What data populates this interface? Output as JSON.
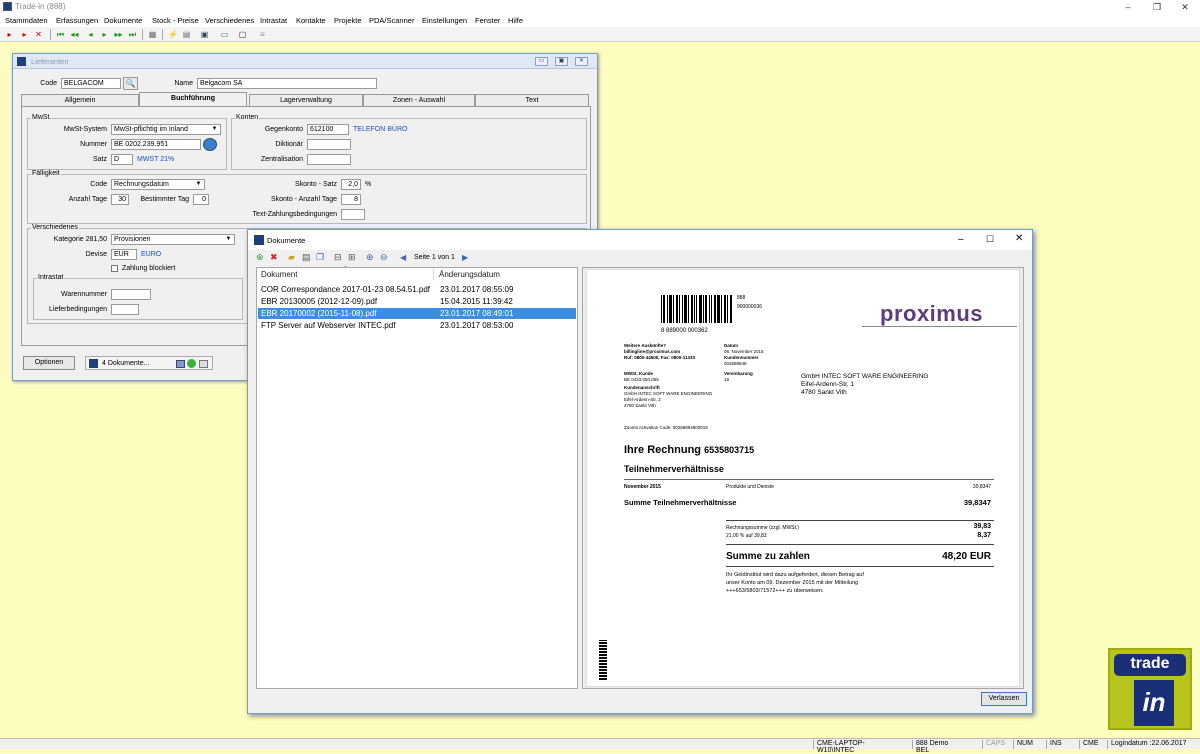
{
  "app": {
    "title": "Trade-in (888)"
  },
  "menu": [
    "Stammdaten",
    "Erfassungen",
    "Dokumente",
    "Stock - Preise",
    "Verschiedenes",
    "Intrastat",
    "Kontakte",
    "Projekte",
    "PDA/Scanner",
    "Einstellungen",
    "Fenster",
    "Hilfe"
  ],
  "lief": {
    "title": "Lieferanten",
    "code_label": "Code",
    "code_value": "BELGACOM",
    "name_label": "Name",
    "name_value": "Belgacom SA",
    "tabs": [
      "Allgemein",
      "Buchführung",
      "Lagerverwaltung",
      "Zonen - Auswahl",
      "Text"
    ],
    "mwst": {
      "group": "MwSt.",
      "system_label": "MwSt-System",
      "system_value": "MwSt-pflichtig im Inland",
      "nummer_label": "Nummer",
      "nummer_value": "BE 0202.239.951",
      "satz_label": "Satz",
      "satz_value": "D",
      "satz_desc": "MWST 21%"
    },
    "konten": {
      "group": "Konten",
      "gegenkonto_label": "Gegenkonto",
      "gegenkonto_value": "612100",
      "gegenkonto_desc": "TELEFON BÜRO",
      "diktionaer_label": "Diktionär",
      "zentral_label": "Zentralisation"
    },
    "faellig": {
      "group": "Fälligkeit",
      "code_label": "Code",
      "code_value": "Rechnungsdatum",
      "anzahl_label": "Anzahl Tage",
      "anzahl_value": "30",
      "bestimmt_label": "Bestimmter Tag",
      "bestimmt_value": "0",
      "skonto_satz_label": "Skonto - Satz",
      "skonto_satz_value": "2,0",
      "skonto_pct": "%",
      "skonto_tage_label": "Skonto - Anzahl Tage",
      "skonto_tage_value": "8",
      "text_label": "Text-Zahlungsbedingungen"
    },
    "versch": {
      "group": "Verschiedenes",
      "kat_label": "Kategorie 281,50",
      "kat_value": "Provisionen",
      "devise_label": "Devise",
      "devise_value": "EUR",
      "devise_desc": "EURO",
      "zahlung_label": "Zahlung blockiert"
    },
    "intrastat": {
      "group": "Intrastat",
      "waren_label": "Warennummer",
      "liefer_label": "Lieferbedingungen"
    },
    "optionen_label": "Optionen",
    "dokumente_label": "4 Dokumente..."
  },
  "doc": {
    "title": "Dokumente",
    "page_info": "Seite 1 von 1",
    "col_doc": "Dokument",
    "col_date": "Änderungsdatum",
    "files": [
      {
        "name": "COR Correspondance 2017-01-23 08.54.51.pdf",
        "date": "23.01.2017 08:55:09"
      },
      {
        "name": "EBR 20130005 (2012-12-09).pdf",
        "date": "15.04.2015 11:39:42"
      },
      {
        "name": "EBR 20170002 (2015-11-08).pdf",
        "date": "23.01.2017 08:49:01"
      },
      {
        "name": "FTP Server auf Webserver INTEC.pdf",
        "date": "23.01.2017 08:53:00"
      }
    ],
    "selected_index": 2,
    "close_label": "Verlassen"
  },
  "invoice": {
    "barcode_num": "8 889000 000362",
    "num1": "888",
    "num2": "900000036",
    "brand": "proximus",
    "weitere": "Weitere Auskünfte?",
    "email": "billingline@proximus.com",
    "ruf": "Ruf: 0800-44500, Fax: 0800-11333",
    "datum_label": "Datum",
    "datum_value": "08. November 2015",
    "kunden_label": "Kundennummer",
    "kunden_value": "002688948",
    "mwst_label": "MWSt. Kunde",
    "mwst_value": "BE 0433.050.065",
    "verein_label": "Vereinbarung",
    "verein_value": "19",
    "anschrift_label": "Kundenanschrift",
    "anschrift": [
      "GmbH INTEC SOFT WARE ENGINEERING",
      "Eifel-Ardenn-Str, 2",
      "4780 Sankt Vith"
    ],
    "addr": [
      "GmbH INTEC SOFT WARE ENGINEERING",
      "Eifel-Ardenn-Str, 1",
      "4780 Sankt Vith"
    ],
    "zoomit": "Zoomit Activation Code: 00268894800019",
    "heading_prefix": "Ihre Rechnung",
    "heading_num": "6535803715",
    "sub": "Teilnehmerverhältnisse",
    "row_month": "November 2015",
    "row_desc": "Produkte und Dienste",
    "row_val": "39,8347",
    "sum_label": "Summe Teilnehmerverhältnisse",
    "sum_val": "39,8347",
    "rsumme_label": "Rechnungssumme (zzgl. MWSt.)",
    "rsumme_val": "39,83",
    "vat_label": "21,00 % auf 39,83",
    "vat_val": "8,37",
    "total_label": "Summe zu zahlen",
    "total_val": "48,20 EUR",
    "note": [
      "Ihr Geldinstitut wird dazu aufgefordert, diesen Betrag auf",
      "unser Konto am 09. Dezember 2015 mit der Mitteilung",
      "+++653/5803/71572+++ zu überweisen."
    ]
  },
  "status": {
    "machine": "CME-LAPTOP-W10\\INTEC",
    "company": "888 Demo BEL",
    "caps": "CAPS",
    "num": "NUM",
    "ins": "INS",
    "user": "CME",
    "login": "Logindatum :22.06.2017"
  },
  "logo": {
    "text": "trade",
    "sub": "in"
  }
}
